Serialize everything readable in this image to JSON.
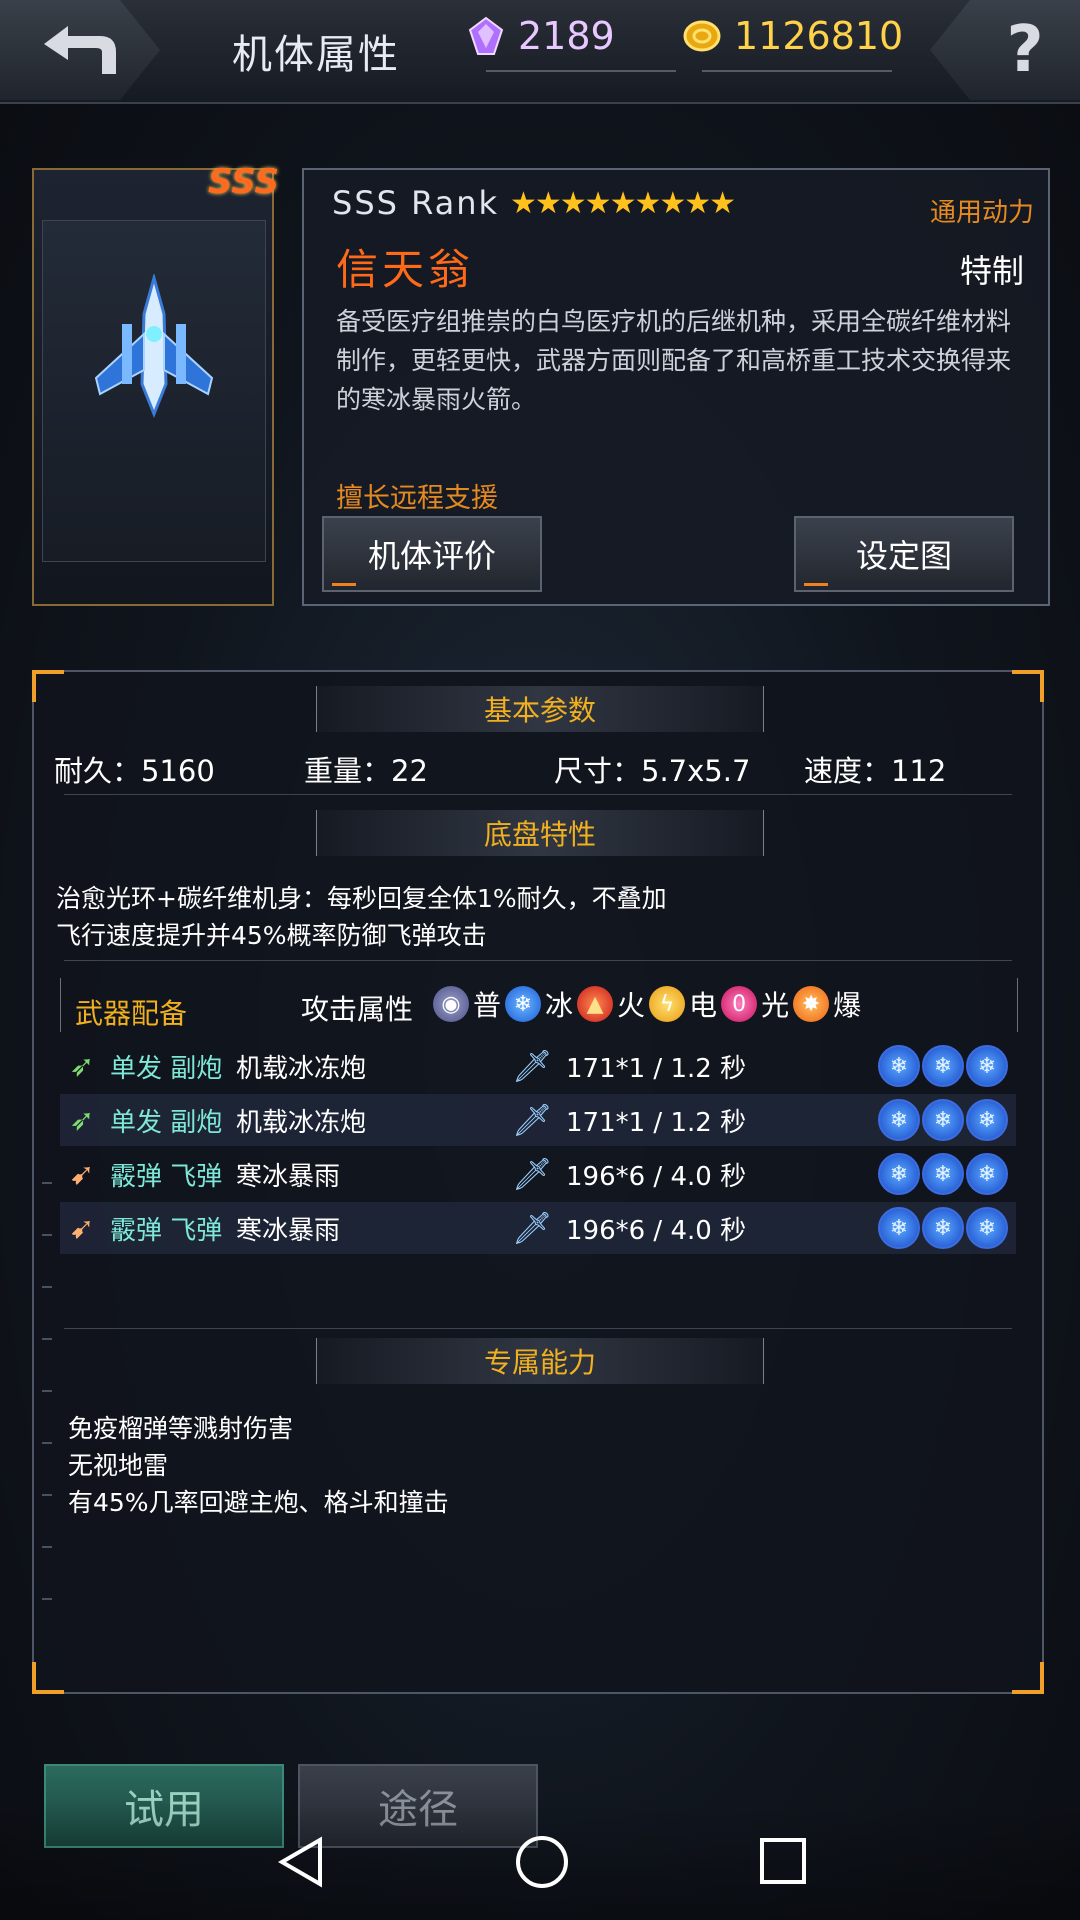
{
  "header": {
    "title": "机体属性",
    "gems": "2189",
    "gold": "1126810",
    "help_label": "?"
  },
  "unit": {
    "rank_badge": "SSS",
    "rank_text": "SSS Rank",
    "stars": "★★★★★★★★★",
    "star_count": 9,
    "power_type": "通用动力",
    "name": "信天翁",
    "tag": "特制",
    "description": "备受医疗组推崇的白鸟医疗机的后继机种，采用全碳纤维材料制作，更轻更快，武器方面则配备了和高桥重工技术交换得来的寒冰暴雨火箭。",
    "specialty": "擅长远程支援",
    "btn_eval": "机体评价",
    "btn_design": "设定图"
  },
  "basic": {
    "heading": "基本参数",
    "stats": [
      {
        "label": "耐久：5160"
      },
      {
        "label": "重量：22"
      },
      {
        "label": "尺寸：5.7x5.7"
      },
      {
        "label": "速度：112"
      }
    ]
  },
  "chassis": {
    "heading": "底盘特性",
    "line1": "治愈光环+碳纤维机身：每秒回复全体1%耐久，不叠加",
    "line2": "飞行速度提升并45%概率防御飞弹攻击"
  },
  "weapons": {
    "heading": "武器配备",
    "attr_label": "攻击属性",
    "elements": [
      {
        "name": "普",
        "icon": "normal-orb"
      },
      {
        "name": "冰",
        "icon": "ice-orb"
      },
      {
        "name": "火",
        "icon": "fire-orb"
      },
      {
        "name": "电",
        "icon": "electric-orb"
      },
      {
        "name": "光",
        "icon": "light-orb"
      },
      {
        "name": "爆",
        "icon": "explosive-orb"
      }
    ],
    "rows": [
      {
        "type": "单发 副炮",
        "name": "机载冰冻炮",
        "damage": "171*1 / 1.2 秒",
        "slots": [
          "ice",
          "ice",
          "ice"
        ]
      },
      {
        "type": "单发 副炮",
        "name": "机载冰冻炮",
        "damage": "171*1 / 1.2 秒",
        "slots": [
          "ice",
          "ice",
          "ice"
        ]
      },
      {
        "type": "霰弹 飞弹",
        "name": "寒冰暴雨",
        "damage": "196*6 / 4.0 秒",
        "slots": [
          "ice",
          "ice",
          "ice"
        ]
      },
      {
        "type": "霰弹 飞弹",
        "name": "寒冰暴雨",
        "damage": "196*6 / 4.0 秒",
        "slots": [
          "ice",
          "ice",
          "ice"
        ]
      }
    ]
  },
  "abilities": {
    "heading": "专属能力",
    "items": [
      "免疫榴弹等溅射伤害",
      "无视地雷",
      "有45%几率回避主炮、格斗和撞击"
    ]
  },
  "bottom": {
    "try_label": "试用",
    "route_label": "途径"
  },
  "colors": {
    "accent_orange": "#f0a028",
    "title_gold": "#f0b020",
    "name_orange": "#ff6a18",
    "weapon_type_cyan": "#7ee8d8"
  }
}
